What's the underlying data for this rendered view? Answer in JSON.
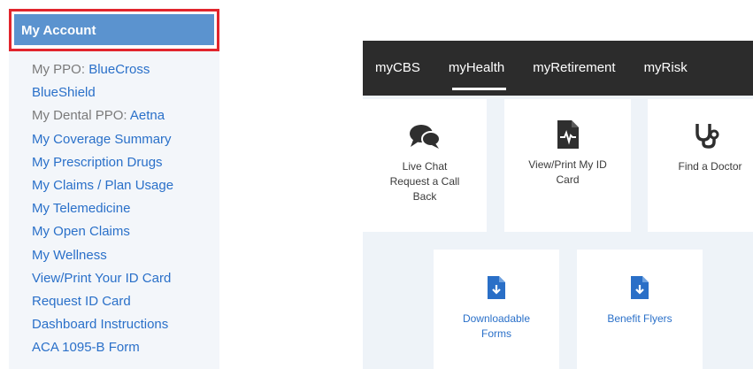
{
  "account": {
    "header": "My Account",
    "items": [
      {
        "prefix": "My PPO: ",
        "link": "BlueCross"
      },
      {
        "link": "BlueShield"
      },
      {
        "prefix": "My Dental PPO: ",
        "link": "Aetna"
      },
      {
        "link": "My Coverage Summary"
      },
      {
        "link": "My Prescription Drugs"
      },
      {
        "link": "My Claims / Plan Usage"
      },
      {
        "link": "My Telemedicine"
      },
      {
        "link": "My Open Claims"
      },
      {
        "link": "My Wellness"
      },
      {
        "link": "View/Print Your ID Card"
      },
      {
        "link": "Request ID Card"
      },
      {
        "link": "Dashboard Instructions"
      },
      {
        "link": "ACA 1095-B Form"
      }
    ]
  },
  "portal": {
    "tabs": [
      "myCBS",
      "myHealth",
      "myRetirement",
      "myRisk"
    ],
    "active_tab": "myHealth",
    "tiles": {
      "chat": {
        "icon": "chat-bubbles-icon",
        "lines": [
          "Live Chat",
          "Request a Call",
          "Back"
        ]
      },
      "id_card": {
        "icon": "id-card-icon",
        "lines": [
          "View/Print My ID",
          "Card"
        ]
      },
      "doctor": {
        "icon": "stethoscope-icon",
        "lines": [
          "Find a Doctor"
        ]
      },
      "forms": {
        "icon": "download-document-icon",
        "lines": [
          "Downloadable",
          "Forms"
        ]
      },
      "flyers": {
        "icon": "download-document-icon",
        "lines": [
          "Benefit Flyers"
        ]
      }
    }
  },
  "colors": {
    "header_bg": "#5b93cf",
    "highlight_border": "#e1252d",
    "link": "#2a70c9",
    "nav_bg": "#2c2c2c",
    "icon_dark": "#2f2f2f",
    "icon_blue": "#2a6fc7"
  }
}
